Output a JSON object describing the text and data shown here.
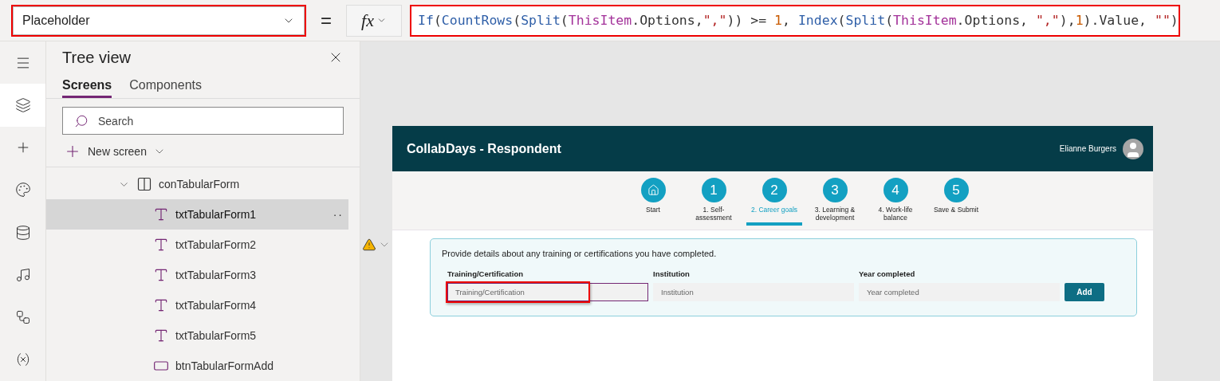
{
  "formula_bar": {
    "property": "Placeholder",
    "equals": "=",
    "fx": "fx",
    "formula": [
      {
        "kind": "fn",
        "text": "If"
      },
      {
        "kind": "plain",
        "text": "("
      },
      {
        "kind": "fn",
        "text": "CountRows"
      },
      {
        "kind": "plain",
        "text": "("
      },
      {
        "kind": "fn",
        "text": "Split"
      },
      {
        "kind": "plain",
        "text": "("
      },
      {
        "kind": "ident",
        "text": "ThisItem"
      },
      {
        "kind": "plain",
        "text": ".Options,"
      },
      {
        "kind": "str",
        "text": "\",\""
      },
      {
        "kind": "plain",
        "text": ")) >= "
      },
      {
        "kind": "num",
        "text": "1"
      },
      {
        "kind": "plain",
        "text": ", "
      },
      {
        "kind": "fn",
        "text": "Index"
      },
      {
        "kind": "plain",
        "text": "("
      },
      {
        "kind": "fn",
        "text": "Split"
      },
      {
        "kind": "plain",
        "text": "("
      },
      {
        "kind": "ident",
        "text": "ThisItem"
      },
      {
        "kind": "plain",
        "text": ".Options, "
      },
      {
        "kind": "str",
        "text": "\",\""
      },
      {
        "kind": "plain",
        "text": "),"
      },
      {
        "kind": "num",
        "text": "1"
      },
      {
        "kind": "plain",
        "text": ").Value, "
      },
      {
        "kind": "str",
        "text": "\"\""
      },
      {
        "kind": "plain",
        "text": ")"
      }
    ]
  },
  "rail": [
    {
      "kind": "menu",
      "selected": false
    },
    {
      "kind": "layers",
      "selected": true
    },
    {
      "kind": "plus",
      "selected": false
    },
    {
      "kind": "palette",
      "selected": false
    },
    {
      "kind": "data",
      "selected": false
    },
    {
      "kind": "media",
      "selected": false
    },
    {
      "kind": "automate",
      "selected": false
    },
    {
      "kind": "variables",
      "selected": false
    }
  ],
  "tree_view": {
    "title": "Tree view",
    "tabs": [
      {
        "label": "Screens",
        "selected": true
      },
      {
        "label": "Components",
        "selected": false
      }
    ],
    "search": {
      "placeholder": "Search"
    },
    "new_screen": "New screen",
    "items": [
      {
        "kind": "container",
        "label": "conTabularForm",
        "expanded": true,
        "selected": false,
        "children": [
          {
            "kind": "text",
            "label": "txtTabularForm1",
            "selected": true,
            "more": "··"
          },
          {
            "kind": "text",
            "label": "txtTabularForm2",
            "selected": false
          },
          {
            "kind": "text",
            "label": "txtTabularForm3",
            "selected": false
          },
          {
            "kind": "text",
            "label": "txtTabularForm4",
            "selected": false
          },
          {
            "kind": "text",
            "label": "txtTabularForm5",
            "selected": false
          },
          {
            "kind": "button",
            "label": "btnTabularFormAdd",
            "selected": false
          }
        ]
      }
    ]
  },
  "app": {
    "title": "CollabDays - Respondent",
    "user": "Elianne Burgers",
    "steps": [
      {
        "kind": "home",
        "label": "Start",
        "selected": false
      },
      {
        "kind": "number",
        "number": "1",
        "label": "1. Self-\nassessment",
        "selected": false
      },
      {
        "kind": "number",
        "number": "2",
        "label": "2. Career goals",
        "selected": true
      },
      {
        "kind": "number",
        "number": "3",
        "label": "3. Learning &\ndevelopment",
        "selected": false
      },
      {
        "kind": "number",
        "number": "4",
        "label": "4. Work-life\nbalance",
        "selected": false
      },
      {
        "kind": "number",
        "number": "5",
        "label": "Save & Submit",
        "selected": false
      }
    ],
    "form": {
      "intro": "Provide details about any training or certifications you have completed.",
      "fields": [
        {
          "label": "Training/Certification",
          "placeholder": "Training/Certification",
          "focused": true
        },
        {
          "label": "Institution",
          "placeholder": "Institution",
          "focused": false
        },
        {
          "label": "Year completed",
          "placeholder": "Year completed",
          "focused": false
        }
      ],
      "button": "Add"
    }
  }
}
